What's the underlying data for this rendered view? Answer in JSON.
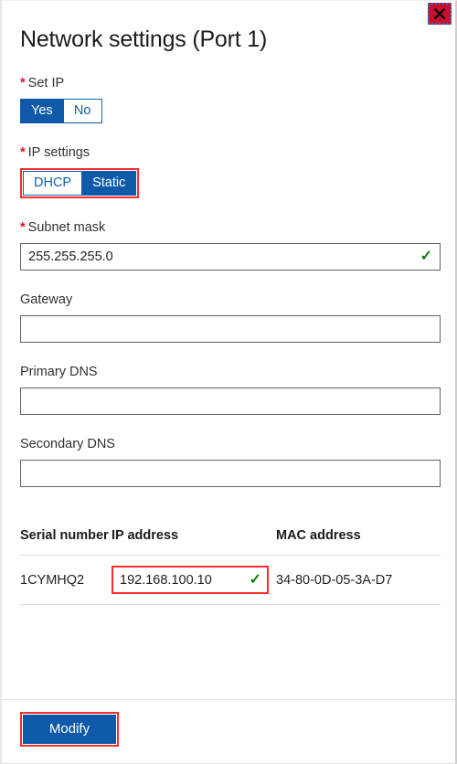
{
  "window": {
    "title": "Network settings (Port 1)",
    "close_icon": "close-icon",
    "close_label": "Close",
    "accent_blue": "#0f5aa8",
    "highlight_red": "#fb2c2c",
    "close_red": "#c8102e",
    "valid_green": "#107c10",
    "required_marker": "*"
  },
  "fields": {
    "set_ip": {
      "label": "Set IP",
      "required": true,
      "options": [
        "Yes",
        "No"
      ],
      "selected": "Yes",
      "highlighted": false
    },
    "ip_settings": {
      "label": "IP settings",
      "required": true,
      "options": [
        "DHCP",
        "Static"
      ],
      "selected": "Static",
      "highlighted": true
    },
    "subnet_mask": {
      "label": "Subnet mask",
      "required": true,
      "value": "255.255.255.0",
      "placeholder": "",
      "valid": true,
      "valid_icon": "checkmark-icon"
    },
    "gateway": {
      "label": "Gateway",
      "required": false,
      "value": "",
      "placeholder": "",
      "valid": false
    },
    "primary_dns": {
      "label": "Primary DNS",
      "required": false,
      "value": "",
      "placeholder": "",
      "valid": false
    },
    "secondary_dns": {
      "label": "Secondary DNS",
      "required": false,
      "value": "",
      "placeholder": "",
      "valid": false
    }
  },
  "table": {
    "headers": [
      "Serial number",
      "IP address",
      "MAC address"
    ],
    "rows": [
      {
        "serial_number": "1CYMHQ2",
        "ip_address": "192.168.100.10",
        "ip_valid": true,
        "ip_valid_icon": "checkmark-icon",
        "ip_highlighted": true,
        "mac_address": "34-80-0D-05-3A-D7"
      }
    ]
  },
  "footer": {
    "modify_label": "Modify",
    "modify_highlighted": true
  }
}
